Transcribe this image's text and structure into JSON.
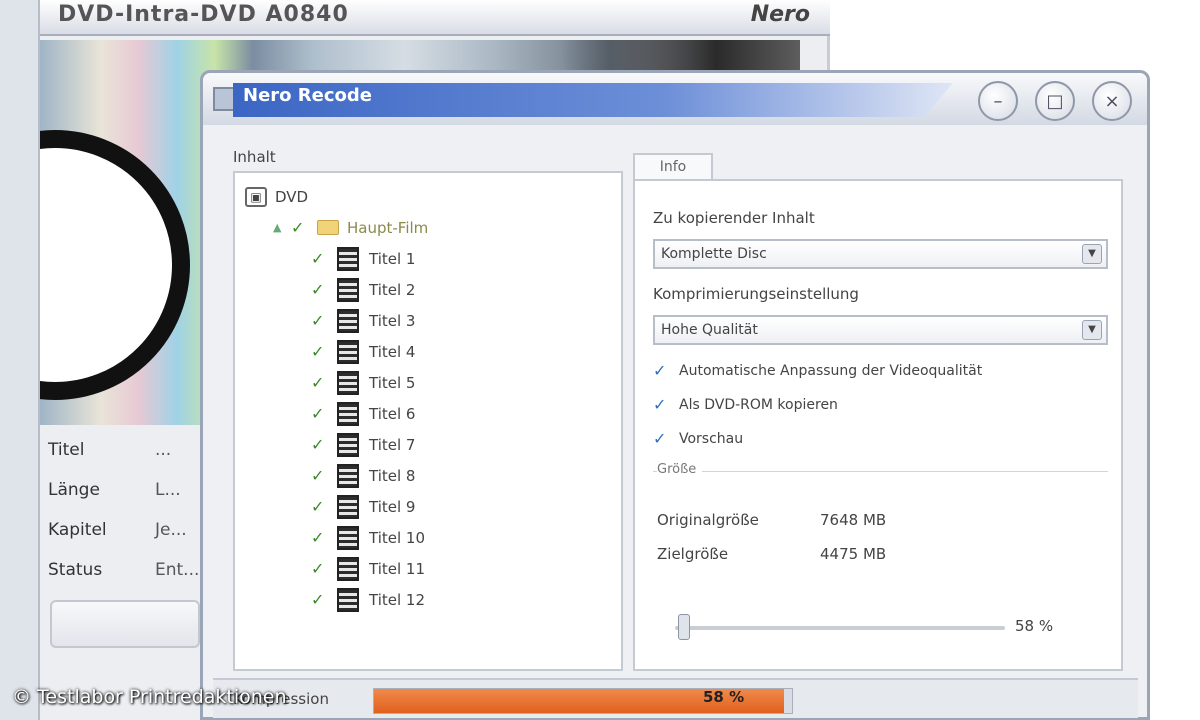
{
  "background_window": {
    "title": "DVD-Intra-DVD A0840",
    "logo": "Nero",
    "properties": [
      {
        "label": "Titel",
        "value": "..."
      },
      {
        "label": "Länge",
        "value": "L..."
      },
      {
        "label": "Kapitel",
        "value": "Je..."
      },
      {
        "label": "Status",
        "value": "Ent..."
      }
    ]
  },
  "dialog": {
    "title": "Nero Recode",
    "window_controls": {
      "minimize": "–",
      "maximize": "□",
      "close": "×"
    },
    "left_panel": {
      "title": "Inhalt",
      "root": "DVD",
      "folder": "Haupt-Film",
      "tracks": [
        "Titel 1",
        "Titel 2",
        "Titel 3",
        "Titel 4",
        "Titel 5",
        "Titel 6",
        "Titel 7",
        "Titel 8",
        "Titel 9",
        "Titel 10",
        "Titel 11",
        "Titel 12"
      ]
    },
    "right_panel": {
      "tab": "Info",
      "content_label": "Zu kopierender Inhalt",
      "content_select": "Komplette Disc",
      "compression_label": "Komprimierungseinstellung",
      "quality_select": "Hohe Qualität",
      "options": [
        "Automatische Anpassung der Videoqualität",
        "Als DVD-ROM kopieren",
        "Vorschau"
      ],
      "group_title": "Größe",
      "original_size_label": "Originalgröße",
      "original_size_value": "7648 MB",
      "target_size_label": "Zielgröße",
      "target_size_value": "4475 MB",
      "compression_percent": "58 %",
      "compression_fraction": 0.02
    },
    "status_bar": {
      "label": "Kompression",
      "value": "58 %",
      "progress_fraction": 0.98
    }
  },
  "watermark": "© Testlabor Printredaktionen",
  "colors": {
    "title_band": "#3b66c4",
    "progress": "#e0601d",
    "check": "#3a8a2a"
  }
}
